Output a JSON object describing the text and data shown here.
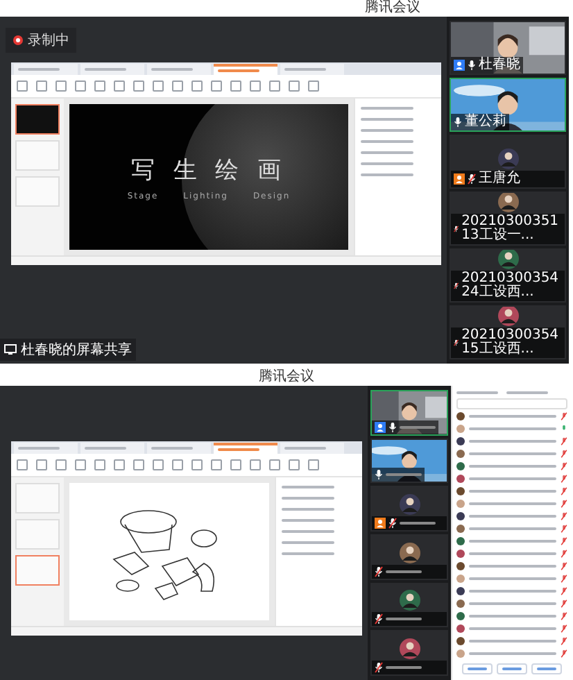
{
  "screens": [
    {
      "app_title": "腾讯会议",
      "recording": "录制中",
      "doc_tabs": [
        {
          "selected": false
        },
        {
          "selected": false
        },
        {
          "selected": false
        },
        {
          "selected": true
        },
        {
          "selected": false
        }
      ],
      "slide": {
        "kind": "title",
        "title": "写 生 绘 画",
        "subtitle": [
          "Stage",
          "Lighting",
          "Design"
        ]
      },
      "share_label": "杜春晓的屏幕共享",
      "videos": [
        {
          "name": "杜春晓",
          "kind": "camera",
          "color": "#2f7cf6",
          "muted": false,
          "selected": false
        },
        {
          "name": "董公莉",
          "kind": "camera",
          "muted": false,
          "selected": true
        },
        {
          "name": "王唐允",
          "kind": "avatar",
          "color": "#f07b1b",
          "muted": true,
          "selected": false
        },
        {
          "name": "2021030035113工设一...",
          "kind": "avatar",
          "muted": true,
          "selected": false
        },
        {
          "name": "2021030035424工设西...",
          "kind": "avatar",
          "muted": true,
          "selected": false
        },
        {
          "name": "2021030035415工设西...",
          "kind": "avatar",
          "muted": true,
          "selected": false
        }
      ]
    },
    {
      "app_title": "腾讯会议",
      "doc_tabs": [
        {
          "selected": false
        },
        {
          "selected": false
        },
        {
          "selected": false
        },
        {
          "selected": true
        },
        {
          "selected": false
        }
      ],
      "slide": {
        "kind": "sketch"
      },
      "videos": [
        {
          "kind": "camera",
          "color": "#2f7cf6",
          "muted": false,
          "selected": true
        },
        {
          "kind": "camera",
          "muted": false,
          "selected": false
        },
        {
          "kind": "avatar",
          "color": "#f07b1b",
          "muted": true,
          "selected": false
        },
        {
          "kind": "avatar",
          "muted": true,
          "selected": false
        },
        {
          "kind": "avatar",
          "muted": true,
          "selected": false
        },
        {
          "kind": "avatar",
          "muted": true,
          "selected": false
        }
      ],
      "participants": [
        {
          "muted": true
        },
        {
          "muted": false
        },
        {
          "muted": true
        },
        {
          "muted": true
        },
        {
          "muted": true
        },
        {
          "muted": true
        },
        {
          "muted": true
        },
        {
          "muted": true
        },
        {
          "muted": true
        },
        {
          "muted": true
        },
        {
          "muted": true
        },
        {
          "muted": true
        },
        {
          "muted": true
        },
        {
          "muted": true
        },
        {
          "muted": true
        },
        {
          "muted": true
        },
        {
          "muted": true
        },
        {
          "muted": true
        },
        {
          "muted": true
        },
        {
          "muted": true
        }
      ]
    }
  ]
}
